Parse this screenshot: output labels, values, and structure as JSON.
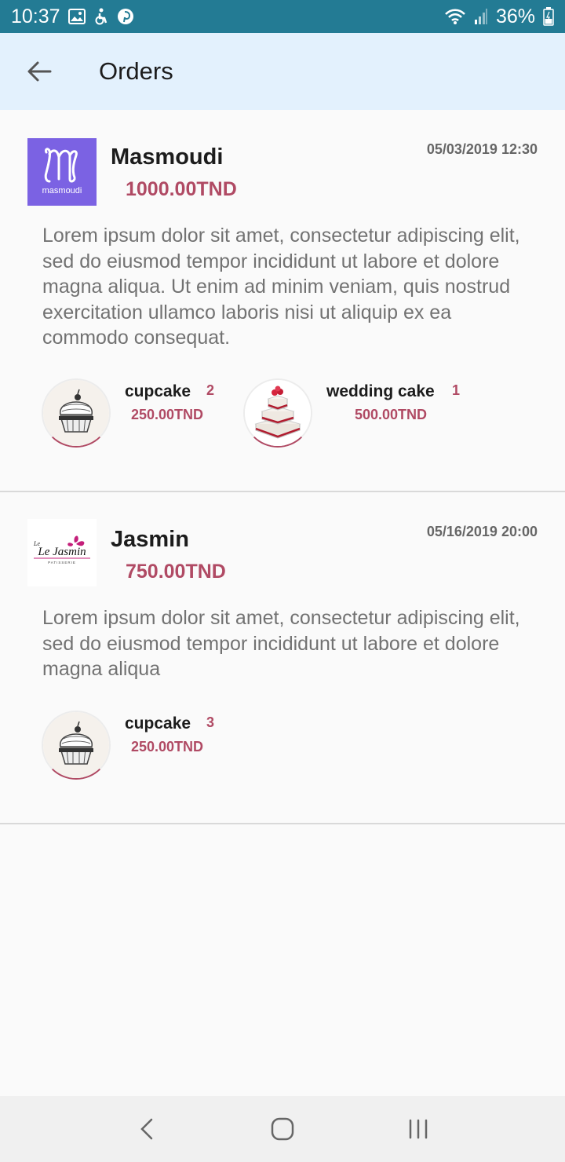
{
  "status_bar": {
    "time": "10:37",
    "battery": "36%",
    "icons": [
      "gallery-icon",
      "wheelchair-icon",
      "pinterest-icon",
      "wifi-icon",
      "signal-icon",
      "battery-icon"
    ]
  },
  "app_bar": {
    "title": "Orders",
    "back_icon": "arrow-left-icon"
  },
  "orders": [
    {
      "store": "Masmoudi",
      "logo_text": "masmoudi",
      "logo_color": "#7b62e3",
      "total": "1000.00TND",
      "date": "05/03/2019 12:30",
      "description": "Lorem ipsum dolor sit amet, consectetur adipiscing elit, sed do eiusmod tempor incididunt ut labore et dolore magna aliqua. Ut enim ad minim veniam, quis nostrud exercitation ullamco laboris nisi ut aliquip ex ea commodo consequat.",
      "items": [
        {
          "name": "cupcake",
          "qty": "2",
          "price": "250.00TND",
          "icon": "cupcake-icon"
        },
        {
          "name": "wedding cake",
          "qty": "1",
          "price": "500.00TND",
          "icon": "wedding-cake-icon"
        }
      ]
    },
    {
      "store": "Jasmin",
      "logo_text": "Le Jasmin",
      "total": "750.00TND",
      "date": "05/16/2019 20:00",
      "description": "Lorem ipsum dolor sit amet, consectetur adipiscing elit, sed do eiusmod tempor incididunt ut labore et dolore magna aliqua",
      "items": [
        {
          "name": "cupcake",
          "qty": "3",
          "price": "250.00TND",
          "icon": "cupcake-icon"
        }
      ]
    }
  ],
  "nav_bar": {
    "icons": [
      "back-chevron-icon",
      "home-circle-icon",
      "recents-icon"
    ]
  },
  "colors": {
    "status_bar": "#237b94",
    "app_bar": "#e3f1fd",
    "accent": "#b04a64"
  }
}
